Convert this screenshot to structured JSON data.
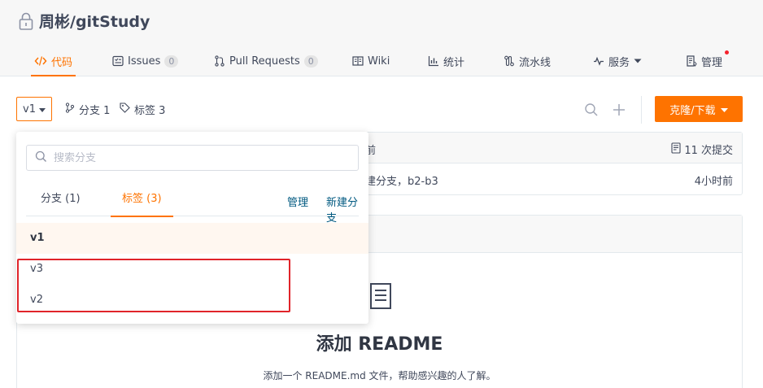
{
  "repo": {
    "path": "周彬/gitStudy"
  },
  "tabs": [
    {
      "label": "代码",
      "icon": "code-icon"
    },
    {
      "label": "Issues",
      "count": "0",
      "icon": "issues-icon"
    },
    {
      "label": "Pull Requests",
      "count": "0",
      "icon": "pull-request-icon"
    },
    {
      "label": "Wiki",
      "icon": "wiki-icon"
    },
    {
      "label": "统计",
      "icon": "stats-icon"
    },
    {
      "label": "流水线",
      "icon": "pipeline-icon"
    },
    {
      "label": "服务",
      "icon": "service-icon"
    },
    {
      "label": "管理",
      "icon": "manage-icon"
    }
  ],
  "toolbar": {
    "current_ref": "v1",
    "branches_label": "分支 1",
    "tags_label": "标签 3",
    "clone_label": "克隆/下载"
  },
  "commit": {
    "partial_text_top": "前",
    "count_label": "11 次提交",
    "partial_message": "建分支，b2-b3",
    "time": "4小时前"
  },
  "readme": {
    "title": "添加 README",
    "subtitle": "添加一个 README.md 文件，帮助感兴趣的人了解。"
  },
  "dropdown": {
    "search_placeholder": "搜索分支",
    "tab_branches": "分支 (1)",
    "tab_tags": "标签 (3)",
    "manage_link": "管理",
    "new_branch_link": "新建分支",
    "items": [
      "v1",
      "v3",
      "v2"
    ]
  },
  "colors": {
    "accent": "#fe7300",
    "highlight": "#e0242a",
    "link": "#005980"
  }
}
